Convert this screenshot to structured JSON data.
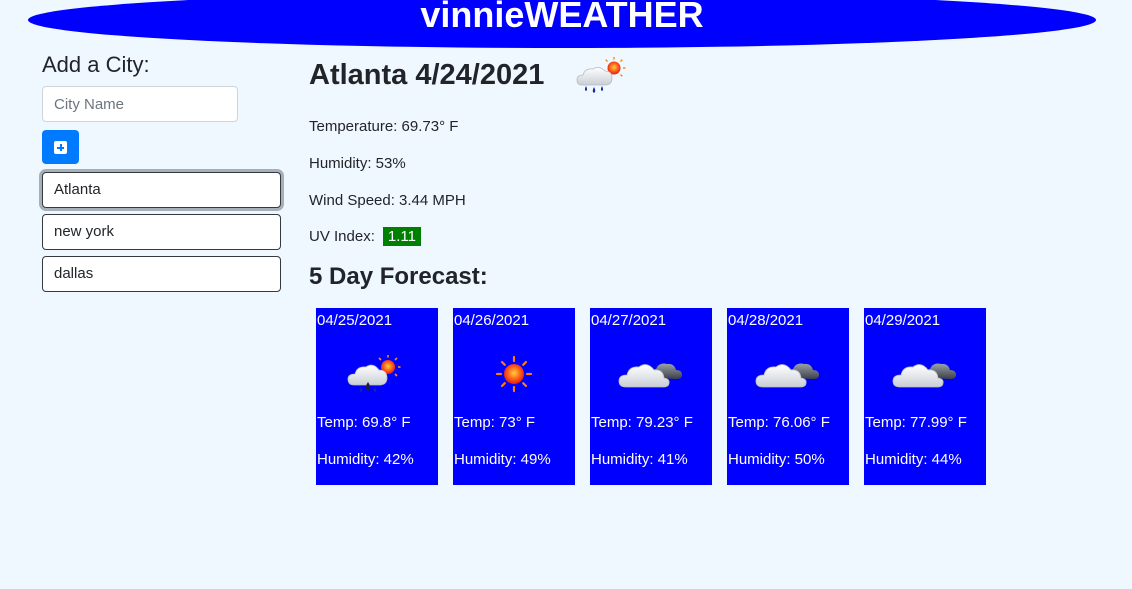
{
  "header": {
    "title": "vinnieWEATHER"
  },
  "sidebar": {
    "heading": "Add a City:",
    "input": {
      "placeholder": "City Name",
      "value": ""
    },
    "add_button_icon": "plus-square-icon",
    "cities": [
      "Atlanta",
      "new york",
      "dallas"
    ],
    "active_city": "Atlanta"
  },
  "current": {
    "title": "Atlanta 4/24/2021",
    "icon": "rain-sun-icon",
    "temperature": "Temperature: 69.73° F",
    "humidity": "Humidity: 53%",
    "wind": "Wind Speed: 3.44 MPH",
    "uv_label": "UV Index:",
    "uv_value": "1.11",
    "uv_color": "#008000"
  },
  "forecast": {
    "title": "5 Day Forecast:",
    "card_color": "#0000ff",
    "days": [
      {
        "date": "04/25/2021",
        "icon": "rain-sun-icon",
        "temp": "Temp: 69.8° F",
        "humidity": "Humidity: 42%"
      },
      {
        "date": "04/26/2021",
        "icon": "sun-icon",
        "temp": "Temp: 73° F",
        "humidity": "Humidity: 49%"
      },
      {
        "date": "04/27/2021",
        "icon": "clouds-icon",
        "temp": "Temp: 79.23° F",
        "humidity": "Humidity: 41%"
      },
      {
        "date": "04/28/2021",
        "icon": "clouds-icon",
        "temp": "Temp: 76.06° F",
        "humidity": "Humidity: 50%"
      },
      {
        "date": "04/29/2021",
        "icon": "clouds-icon",
        "temp": "Temp: 77.99° F",
        "humidity": "Humidity: 44%"
      }
    ]
  }
}
